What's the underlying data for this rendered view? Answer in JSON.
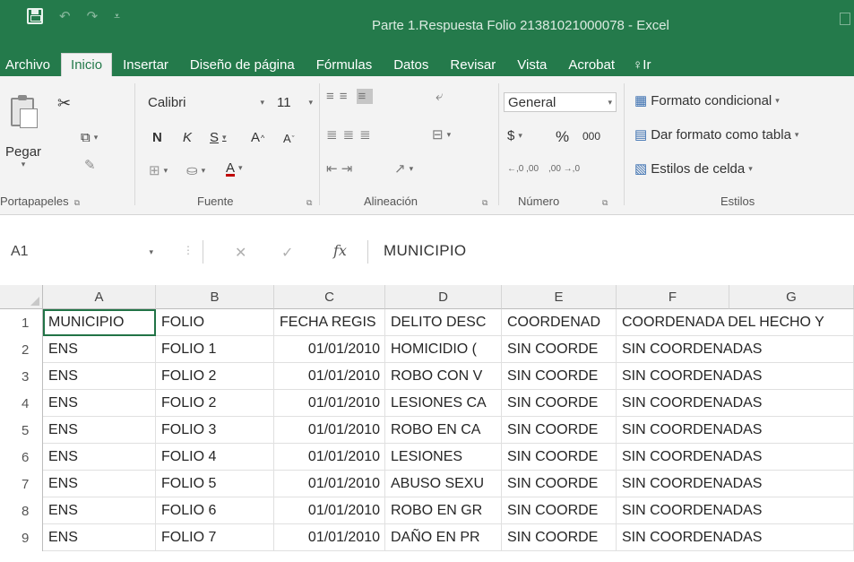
{
  "window": {
    "title": "Parte 1.Respuesta Folio 21381021000078 - Excel",
    "quick_access": [
      "save-icon",
      "undo-icon",
      "redo-icon",
      "customize-icon"
    ]
  },
  "tabs": [
    "Archivo",
    "Inicio",
    "Insertar",
    "Diseño de página",
    "Fórmulas",
    "Datos",
    "Revisar",
    "Vista",
    "Acrobat"
  ],
  "active_tab": "Inicio",
  "tell_me_fragment": "Ir",
  "ribbon": {
    "clipboard": {
      "paste_label": "Pegar",
      "group_label": "Portapapeles"
    },
    "font": {
      "font_name": "Calibri",
      "font_size": "11",
      "bold": "N",
      "italic": "K",
      "underline": "S",
      "grow": "A",
      "shrink": "A",
      "font_color": "A",
      "group_label": "Fuente"
    },
    "alignment": {
      "group_label": "Alineación"
    },
    "number": {
      "format": "General",
      "currency": "$",
      "percent": "%",
      "thousands": "000",
      "increase_decimals": "←,0 ,00",
      "decrease_decimals": ",00 →,0",
      "group_label": "Número"
    },
    "styles": {
      "conditional": "Formato condicional",
      "as_table": "Dar formato como tabla",
      "cell_styles": "Estilos de celda",
      "group_label": "Estilos"
    }
  },
  "formula_bar": {
    "name_box": "A1",
    "fx": "fx",
    "content": "MUNICIPIO"
  },
  "sheet": {
    "columns": [
      "A",
      "B",
      "C",
      "D",
      "E",
      "F",
      "G"
    ],
    "row_numbers": [
      "1",
      "2",
      "3",
      "4",
      "5",
      "6",
      "7",
      "8",
      "9"
    ],
    "header_row": [
      "MUNICIPIO",
      "FOLIO",
      "FECHA REGIS",
      "DELITO DESC",
      "COORDENAD",
      "COORDENADA DEL HECHO Y",
      ""
    ],
    "rows": [
      [
        "ENS",
        "FOLIO 1",
        "01/01/2010",
        "HOMICIDIO (",
        "SIN COORDE",
        "SIN COORDENADAS",
        ""
      ],
      [
        "ENS",
        "FOLIO 2",
        "01/01/2010",
        "ROBO CON V",
        "SIN COORDE",
        "SIN COORDENADAS",
        ""
      ],
      [
        "ENS",
        "FOLIO 2",
        "01/01/2010",
        "LESIONES CA",
        "SIN COORDE",
        "SIN COORDENADAS",
        ""
      ],
      [
        "ENS",
        "FOLIO 3",
        "01/01/2010",
        "ROBO EN CA",
        "SIN COORDE",
        "SIN COORDENADAS",
        ""
      ],
      [
        "ENS",
        "FOLIO 4",
        "01/01/2010",
        "LESIONES",
        "SIN COORDE",
        "SIN COORDENADAS",
        ""
      ],
      [
        "ENS",
        "FOLIO 5",
        "01/01/2010",
        "ABUSO SEXU",
        "SIN COORDE",
        "SIN COORDENADAS",
        ""
      ],
      [
        "ENS",
        "FOLIO 6",
        "01/01/2010",
        "ROBO EN GR",
        "SIN COORDE",
        "SIN COORDENADAS",
        ""
      ],
      [
        "ENS",
        "FOLIO 7",
        "01/01/2010",
        "DAÑO EN PR",
        "SIN COORDE",
        "SIN COORDENADAS",
        ""
      ]
    ]
  },
  "colors": {
    "excel_green": "#247a4b",
    "ribbon_bg": "#f3f3f3",
    "selection": "#217346"
  }
}
